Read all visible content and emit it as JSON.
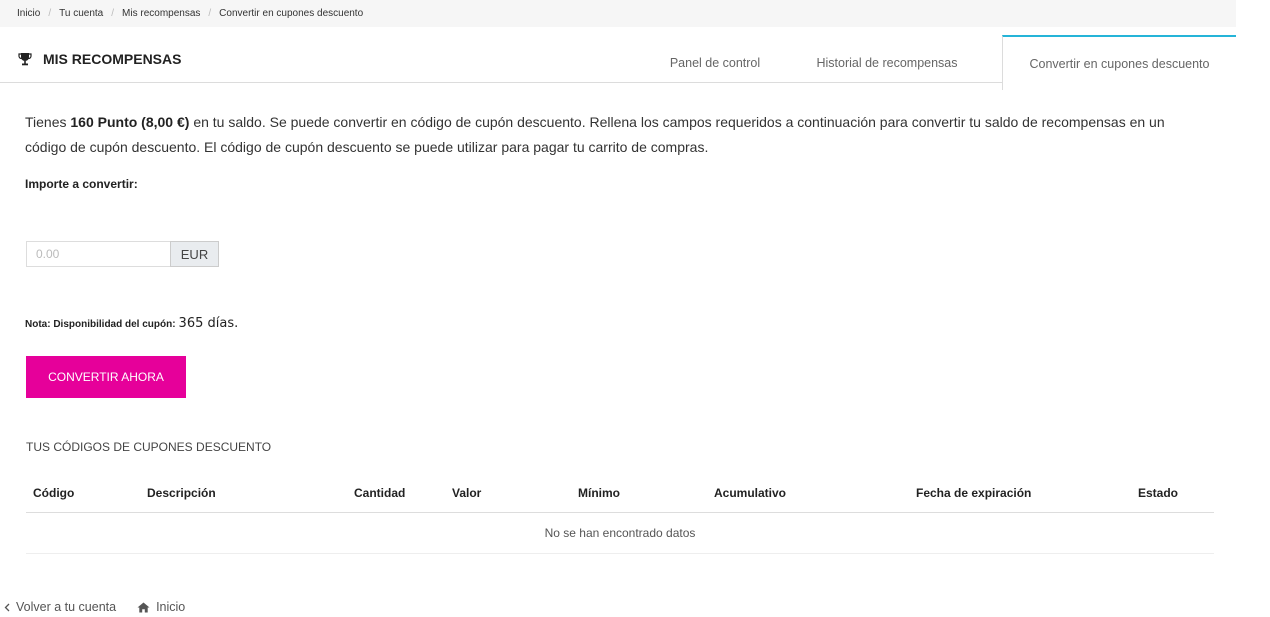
{
  "breadcrumb": {
    "items": [
      "Inicio",
      "Tu cuenta",
      "Mis recompensas",
      "Convertir en cupones descuento"
    ],
    "separator": "/"
  },
  "header": {
    "title": "MIS RECOMPENSAS",
    "title_icon": "trophy-icon"
  },
  "tabs": [
    {
      "label": "Panel de control",
      "active": false
    },
    {
      "label": "Historial de recompensas",
      "active": false
    },
    {
      "label": "Convertir en cupones descuento",
      "active": true
    }
  ],
  "intro": {
    "prefix": "Tienes ",
    "points": "160 Punto (8,00 €)",
    "suffix": " en tu saldo. Se puede convertir en código de cupón descuento. Rellena los campos requeridos a continuación para convertir tu saldo de recompensas en un código de cupón descuento. El código de cupón descuento se puede utilizar para pagar tu carrito de compras."
  },
  "amount": {
    "label": "Importe a convertir:",
    "placeholder": "0.00",
    "value": "",
    "currency": "EUR"
  },
  "note": {
    "label": "Nota: Disponibilidad del cupón:",
    "value": "365 días."
  },
  "convert_button": "CONVERTIR AHORA",
  "codes": {
    "title": "TUS CÓDIGOS DE CUPONES DESCUENTO",
    "columns": [
      "Código",
      "Descripción",
      "Cantidad",
      "Valor",
      "Mínimo",
      "Acumulativo",
      "Fecha de expiración",
      "Estado"
    ],
    "empty_message": "No se han encontrado datos"
  },
  "footer": {
    "back_label": "Volver a tu cuenta",
    "back_icon": "chevron-left-icon",
    "home_label": "Inicio",
    "home_icon": "home-icon"
  },
  "colors": {
    "accent_tab": "#25b4d8",
    "button": "#e6009a"
  }
}
